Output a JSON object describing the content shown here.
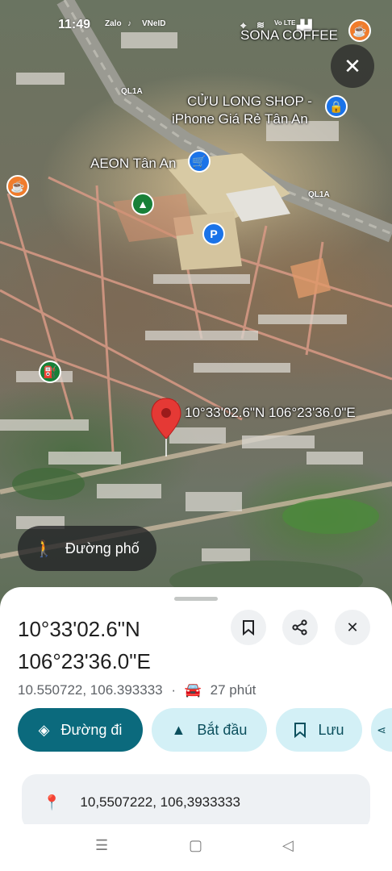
{
  "status_bar": {
    "time": "11:49",
    "app_icons": [
      "Zalo",
      "TikTok",
      "VNeID"
    ],
    "network": "Vo LTE"
  },
  "map": {
    "close_label": "✕",
    "labels": {
      "sona": "SONA COFFEE",
      "cuulong_line1": "CỬU LONG SHOP -",
      "cuulong_line2": "iPhone Giá Rẻ Tân An",
      "aeon": "AEON Tân An",
      "coords": "10°33'02.6\"N 106°23'36.0\"E"
    },
    "roads": {
      "ql1a_top": "QL1A",
      "ql1a_right": "QL1A"
    },
    "poi_icons": {
      "parking": "P"
    },
    "street_view_label": "Đường phố"
  },
  "place": {
    "title_line1": "10°33'02.6\"N",
    "title_line2": "106°23'36.0\"E",
    "decimal_coords": "10.550722, 106.393333",
    "separator": "·",
    "drive_time": "27 phút",
    "actions": {
      "directions": "Đường đi",
      "start": "Bắt đầu",
      "save": "Lưu"
    },
    "address_coords": "10,5507222, 106,3933333"
  },
  "colors": {
    "primary": "#0b6a7d",
    "secondary": "#d3f0f6",
    "pin": "#e53935",
    "coffee": "#f07c2c",
    "shopping": "#1a73e8",
    "park": "#188038"
  }
}
